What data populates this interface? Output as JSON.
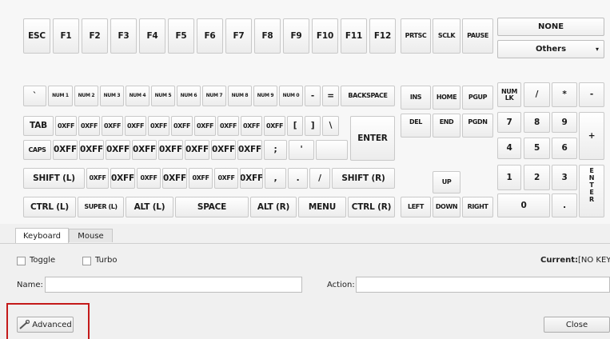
{
  "keyboard": {
    "top_row": [
      "ESC",
      "F1",
      "F2",
      "F3",
      "F4",
      "F5",
      "F6",
      "F7",
      "F8",
      "F9",
      "F10",
      "F11",
      "F12"
    ],
    "nav_top": [
      "PRTSC",
      "SCLK",
      "PAUSE"
    ],
    "num_row": [
      "`",
      "NUM 1",
      "NUM 2",
      "NUM 3",
      "NUM 4",
      "NUM 5",
      "NUM 6",
      "NUM 7",
      "NUM 8",
      "NUM 9",
      "NUM 0",
      "-",
      "=",
      "BACKSPACE"
    ],
    "tab_row": [
      "TAB",
      "0XFF",
      "0XFF",
      "0XFF",
      "0XFF",
      "0XFF",
      "0XFF",
      "0XFF",
      "0XFF",
      "0XFF",
      "0XFF",
      "[",
      "]",
      "\\"
    ],
    "enter": "ENTER",
    "caps_row": [
      "CAPS",
      "0XFF",
      "0XFF",
      "0XFF",
      "0XFF",
      "0XFF",
      "0XFF",
      "0XFF",
      "0XFF",
      ";",
      "'"
    ],
    "shift_row": [
      "SHIFT (L)",
      "0XFF",
      "0XFF",
      "0XFF",
      "0XFF",
      "0XFF",
      "0XFF",
      "0XFF",
      ",",
      ".",
      "/",
      "SHIFT (R)"
    ],
    "ctrl_row": [
      "CTRL (L)",
      "SUPER (L)",
      "ALT (L)",
      "SPACE",
      "ALT (R)",
      "MENU",
      "CTRL (R)"
    ],
    "nav_keys": [
      "INS",
      "HOME",
      "PGUP",
      "DEL",
      "END",
      "PGDN"
    ],
    "arrows": [
      "UP",
      "LEFT",
      "DOWN",
      "RIGHT"
    ],
    "numpad": [
      "NUM LK",
      "/",
      "*",
      "-",
      "7",
      "8",
      "9",
      "+",
      "4",
      "5",
      "6",
      "1",
      "2",
      "3",
      "ENTER",
      "0",
      "."
    ],
    "numpad_enter_letters": [
      "E",
      "N",
      "T",
      "E",
      "R"
    ]
  },
  "dropdowns": {
    "top": "NONE",
    "bottom": "Others"
  },
  "tabs": [
    "Keyboard",
    "Mouse"
  ],
  "options": {
    "toggle": "Toggle",
    "turbo": "Turbo",
    "current_label": "Current:",
    "current_value": "[NO KEY"
  },
  "fields": {
    "name_label": "Name:",
    "name_value": "",
    "action_label": "Action:",
    "action_value": ""
  },
  "buttons": {
    "advanced": "Advanced",
    "close": "Close"
  }
}
